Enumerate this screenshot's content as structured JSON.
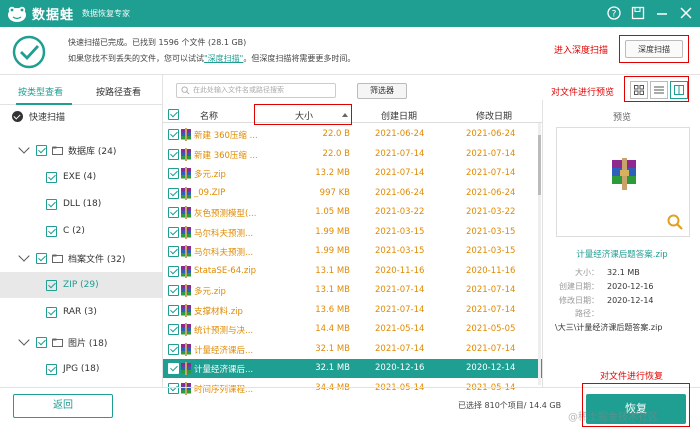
{
  "titlebar": {
    "app_name": "数据蛙",
    "subtitle": "数据恢复专家"
  },
  "status": {
    "line1": "快速扫描已完成。已找到 1596 个文件 (28.1 GB)",
    "line2_pre": "如果您找不到丢失的文件，您可以试试",
    "line2_link": "\"深度扫描\"",
    "line2_post": "。但深度扫描将需要更多时间。",
    "deep_scan_btn": "深度扫描"
  },
  "annotations": {
    "deep": "进入深度扫描",
    "preview": "对文件进行预览",
    "recover": "对文件进行恢复"
  },
  "left": {
    "tab_type": "按类型查看",
    "tab_path": "按路径查看",
    "quick_scan": "快速扫描",
    "tree": [
      {
        "label": "数据库 (24)",
        "level": 0
      },
      {
        "label": "EXE (4)",
        "level": 1
      },
      {
        "label": "DLL (18)",
        "level": 1
      },
      {
        "label": "C (2)",
        "level": 1
      },
      {
        "label": "档案文件 (32)",
        "level": 0
      },
      {
        "label": "ZIP (29)",
        "level": 1,
        "selected": true
      },
      {
        "label": "RAR (3)",
        "level": 1
      },
      {
        "label": "图片 (18)",
        "level": 0
      },
      {
        "label": "JPG (18)",
        "level": 1
      }
    ]
  },
  "toolbar": {
    "search_placeholder": "在此处输入文件名或路径搜索",
    "filter_btn": "筛选器"
  },
  "table": {
    "headers": {
      "name": "名称",
      "size": "大小",
      "created": "创建日期",
      "modified": "修改日期"
    },
    "rows": [
      {
        "name": "新建 360压缩 ...",
        "size": "22.0  B",
        "created": "2021-06-24",
        "modified": "2021-06-24"
      },
      {
        "name": "新建 360压缩 ...",
        "size": "22.0  B",
        "created": "2021-07-14",
        "modified": "2021-07-14"
      },
      {
        "name": "多元.zip",
        "size": "13.2 MB",
        "created": "2021-07-14",
        "modified": "2021-07-14"
      },
      {
        "name": "_09.ZIP",
        "size": "997 KB",
        "created": "2021-06-24",
        "modified": "2021-06-24"
      },
      {
        "name": "灰色预测模型(...",
        "size": "1.05 MB",
        "created": "2021-03-22",
        "modified": "2021-03-22"
      },
      {
        "name": "马尔科夫预测...",
        "size": "1.99 MB",
        "created": "2021-03-15",
        "modified": "2021-03-15"
      },
      {
        "name": "马尔科夫预测...",
        "size": "1.99 MB",
        "created": "2021-03-15",
        "modified": "2021-03-15"
      },
      {
        "name": "StataSE-64.zip",
        "size": "13.1 MB",
        "created": "2020-11-16",
        "modified": "2020-11-16"
      },
      {
        "name": "多元.zip",
        "size": "13.1 MB",
        "created": "2021-07-14",
        "modified": "2021-07-14"
      },
      {
        "name": "支撑材料.zip",
        "size": "13.6 MB",
        "created": "2021-07-14",
        "modified": "2021-07-14"
      },
      {
        "name": "统计预测与决...",
        "size": "14.4 MB",
        "created": "2021-05-14",
        "modified": "2021-05-05"
      },
      {
        "name": "计量经济课后...",
        "size": "32.1 MB",
        "created": "2021-07-14",
        "modified": "2021-07-14"
      },
      {
        "name": "计量经济课后...",
        "size": "32.1 MB",
        "created": "2020-12-16",
        "modified": "2020-12-14",
        "selected": true
      },
      {
        "name": "时间序列课程...",
        "size": "34.4 MB",
        "created": "2021-05-14",
        "modified": "2021-05-14"
      }
    ]
  },
  "preview": {
    "title": "预览",
    "filename": "计量经济课后题答案.zip",
    "size_k": "大小：",
    "size_v": "32.1 MB",
    "created_k": "创建日期：",
    "created_v": "2020-12-16",
    "modified_k": "修改日期：",
    "modified_v": "2020-12-14",
    "path_k": "路径：",
    "path_v": "\\大三\\计量经济课后题答案.zip"
  },
  "bottom": {
    "back_btn": "返回",
    "selected_info": "已选择 810个项目/ 14.4 GB",
    "recover_btn": "恢复",
    "watermark": "@稀土掘金技术社区"
  }
}
